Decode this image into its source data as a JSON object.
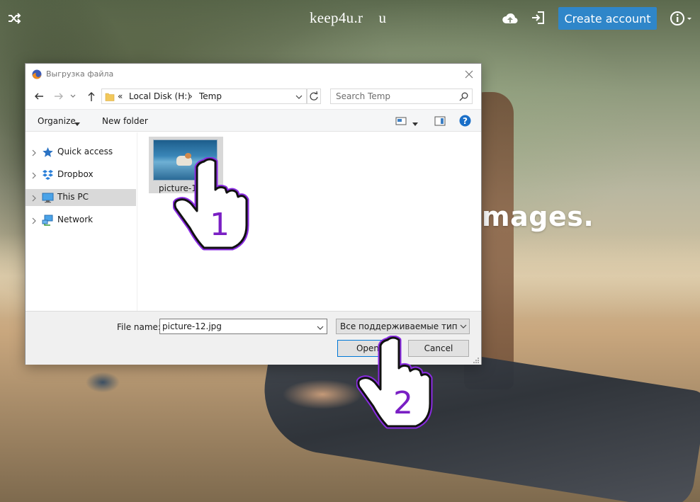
{
  "site": {
    "brand": "keep4u.r    u",
    "hero_text": "mages.",
    "create_account_label": "Create account",
    "colors": {
      "accent": "#2f86c9"
    }
  },
  "icons": {
    "shuffle": "shuffle-icon",
    "upload": "cloud-upload-icon",
    "login": "sign-in-icon",
    "info": "info-circle-icon"
  },
  "dialog": {
    "title": "Выгрузка файла",
    "address": {
      "prefix": "«",
      "crumbs": [
        "Local Disk (H:)",
        "Temp"
      ],
      "separator": "›"
    },
    "search_placeholder": "Search Temp",
    "toolbar": {
      "organize_label": "Organize",
      "new_folder_label": "New folder"
    },
    "nav_items": [
      {
        "label": "Quick access",
        "icon": "star-icon"
      },
      {
        "label": "Dropbox",
        "icon": "dropbox-icon"
      },
      {
        "label": "This PC",
        "icon": "computer-icon",
        "selected": true
      },
      {
        "label": "Network",
        "icon": "network-icon"
      }
    ],
    "files": [
      {
        "name": "picture-12",
        "selected": true
      }
    ],
    "file_name_label": "File name:",
    "file_name_value": "picture-12.jpg",
    "file_type_value": "Все поддерживаемые типы (*.",
    "open_label": "Open",
    "cancel_label": "Cancel"
  },
  "overlays": {
    "steps": [
      {
        "number": "1",
        "color": "#7a1fc4"
      },
      {
        "number": "2",
        "color": "#7a1fc4"
      }
    ]
  }
}
